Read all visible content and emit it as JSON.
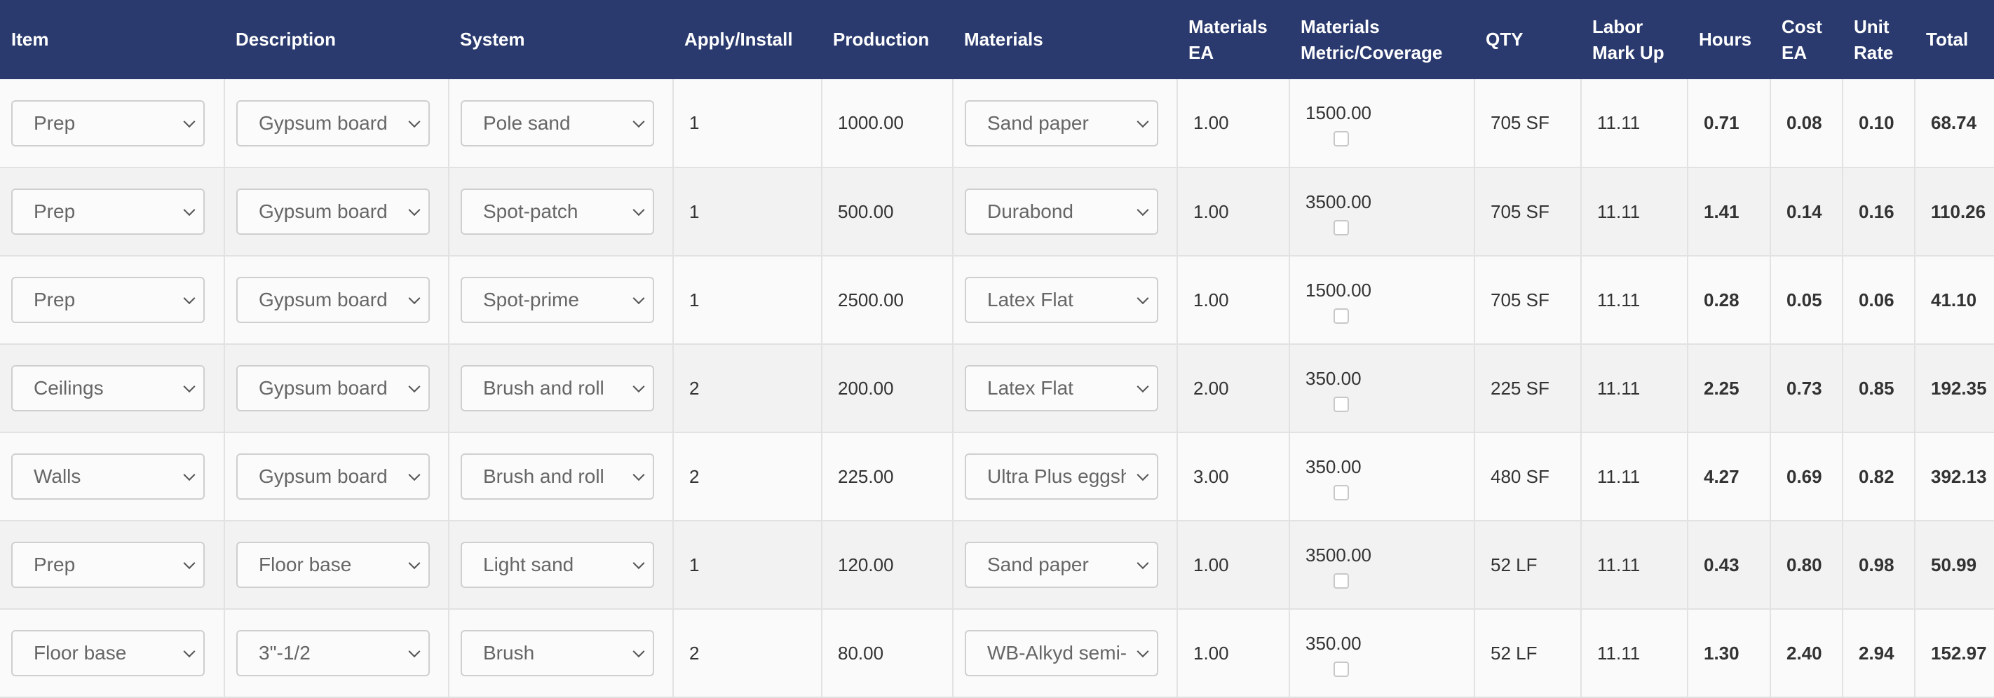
{
  "headers": {
    "item": "Item",
    "description": "Description",
    "system": "System",
    "apply_install": "Apply/Install",
    "production": "Production",
    "materials": "Materials",
    "materials_ea_1": "Materials",
    "materials_ea_2": "EA",
    "coverage_1": "Materials",
    "coverage_2": "Metric/Coverage",
    "qty": "QTY",
    "labor_1": "Labor",
    "labor_2": "Mark Up",
    "hours": "Hours",
    "cost_1": "Cost",
    "cost_2": "EA",
    "unit_1": "Unit",
    "unit_2": "Rate",
    "total": "Total"
  },
  "rows": [
    {
      "item": "Prep",
      "description": "Gypsum board",
      "system": "Pole sand",
      "apply": "1",
      "production": "1000.00",
      "materials": "Sand paper",
      "mat_ea": "1.00",
      "coverage": "1500.00",
      "qty": "705 SF",
      "labor": "11.11",
      "hours": "0.71",
      "cost": "0.08",
      "unit": "0.10",
      "total": "68.74"
    },
    {
      "item": "Prep",
      "description": "Gypsum board",
      "system": "Spot-patch",
      "apply": "1",
      "production": "500.00",
      "materials": "Durabond",
      "mat_ea": "1.00",
      "coverage": "3500.00",
      "qty": "705 SF",
      "labor": "11.11",
      "hours": "1.41",
      "cost": "0.14",
      "unit": "0.16",
      "total": "110.26"
    },
    {
      "item": "Prep",
      "description": "Gypsum board",
      "system": "Spot-prime",
      "apply": "1",
      "production": "2500.00",
      "materials": "Latex Flat",
      "mat_ea": "1.00",
      "coverage": "1500.00",
      "qty": "705 SF",
      "labor": "11.11",
      "hours": "0.28",
      "cost": "0.05",
      "unit": "0.06",
      "total": "41.10"
    },
    {
      "item": "Ceilings",
      "description": "Gypsum board",
      "system": "Brush and roll",
      "apply": "2",
      "production": "200.00",
      "materials": "Latex Flat",
      "mat_ea": "2.00",
      "coverage": "350.00",
      "qty": "225 SF",
      "labor": "11.11",
      "hours": "2.25",
      "cost": "0.73",
      "unit": "0.85",
      "total": "192.35"
    },
    {
      "item": "Walls",
      "description": "Gypsum board",
      "system": "Brush and roll",
      "apply": "2",
      "production": "225.00",
      "materials": "Ultra Plus eggshell",
      "mat_ea": "3.00",
      "coverage": "350.00",
      "qty": "480 SF",
      "labor": "11.11",
      "hours": "4.27",
      "cost": "0.69",
      "unit": "0.82",
      "total": "392.13"
    },
    {
      "item": "Prep",
      "description": "Floor base",
      "system": "Light sand",
      "apply": "1",
      "production": "120.00",
      "materials": "Sand paper",
      "mat_ea": "1.00",
      "coverage": "3500.00",
      "qty": "52 LF",
      "labor": "11.11",
      "hours": "0.43",
      "cost": "0.80",
      "unit": "0.98",
      "total": "50.99"
    },
    {
      "item": "Floor base",
      "description": "3\"-1/2",
      "system": "Brush",
      "apply": "2",
      "production": "80.00",
      "materials": "WB-Alkyd semi-gloss",
      "mat_ea": "1.00",
      "coverage": "350.00",
      "qty": "52 LF",
      "labor": "11.11",
      "hours": "1.30",
      "cost": "2.40",
      "unit": "2.94",
      "total": "152.97"
    }
  ]
}
